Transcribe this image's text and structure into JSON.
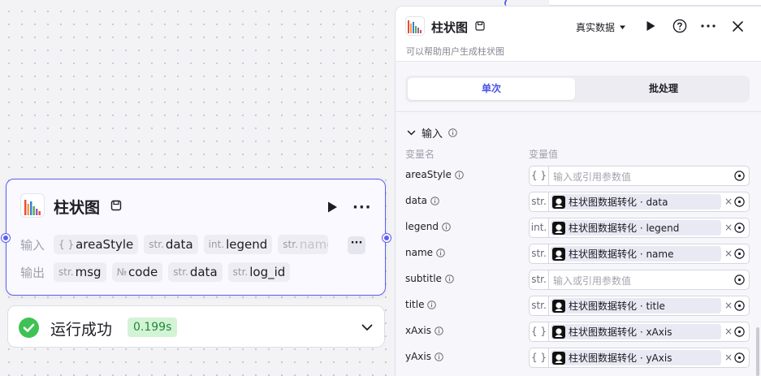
{
  "node": {
    "title": "柱状图",
    "inputs_label": "输入",
    "outputs_label": "输出",
    "inputs": [
      {
        "type": "{ }",
        "name": "areaStyle"
      },
      {
        "type": "str.",
        "name": "data"
      },
      {
        "type": "int.",
        "name": "legend"
      },
      {
        "type": "str.",
        "name": "name"
      }
    ],
    "outputs": [
      {
        "type": "str.",
        "name": "msg"
      },
      {
        "type": "№",
        "name": "code"
      },
      {
        "type": "str.",
        "name": "data"
      },
      {
        "type": "str.",
        "name": "log_id"
      }
    ],
    "more": "···"
  },
  "status": {
    "text": "运行成功",
    "time": "0.199s"
  },
  "panel": {
    "title": "柱状图",
    "description": "可以帮助用户生成柱状图",
    "mode": "真实数据",
    "tabs": {
      "single": "单次",
      "batch": "批处理"
    },
    "section": "输入",
    "col_name": "变量名",
    "col_value": "变量值",
    "placeholder": "输入或引用参数值",
    "rows": [
      {
        "name": "areaStyle",
        "type": "{ }",
        "ref": ""
      },
      {
        "name": "data",
        "type": "str.",
        "ref": "柱状图数据转化 · data"
      },
      {
        "name": "legend",
        "type": "int.",
        "ref": "柱状图数据转化 · legend"
      },
      {
        "name": "name",
        "type": "str.",
        "ref": "柱状图数据转化 · name"
      },
      {
        "name": "subtitle",
        "type": "str.",
        "ref": ""
      },
      {
        "name": "title",
        "type": "str.",
        "ref": "柱状图数据转化 · title"
      },
      {
        "name": "xAxis",
        "type": "{ }",
        "ref": "柱状图数据转化 · xAxis"
      },
      {
        "name": "yAxis",
        "type": "{ }",
        "ref": "柱状图数据转化 · yAxis"
      }
    ]
  },
  "colors": {
    "accent": "#4d53e8",
    "success": "#3ec254"
  }
}
